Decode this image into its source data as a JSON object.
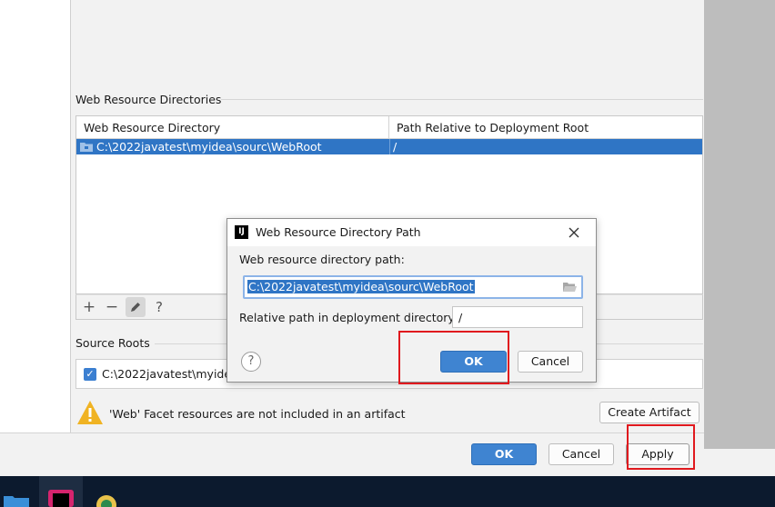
{
  "web_resource": {
    "section_title": "Web Resource Directories",
    "col_directory": "Web Resource Directory",
    "col_path": "Path Relative to Deployment Root",
    "rows": [
      {
        "directory": "C:\\2022javatest\\myidea\\sourc\\WebRoot",
        "path": "/"
      }
    ],
    "toolbar": {
      "add": "+",
      "remove": "−",
      "edit": "pencil-icon",
      "help": "?"
    }
  },
  "source_roots": {
    "section_title": "Source Roots",
    "item": "C:\\2022javatest\\myidea\\",
    "checked": true
  },
  "warning": {
    "text": "'Web' Facet resources are not included in an artifact",
    "create_artifact_label": "Create Artifact"
  },
  "footer": {
    "ok_label": "OK",
    "cancel_label": "Cancel",
    "apply_label": "Apply"
  },
  "dialog": {
    "title": "Web Resource Directory Path",
    "path_label": "Web resource directory path:",
    "path_value": "C:\\2022javatest\\myidea\\sourc\\WebRoot",
    "relative_label": "Relative path in deployment directory:",
    "relative_value": "/",
    "ok_label": "OK",
    "cancel_label": "Cancel",
    "help_label": "?"
  },
  "colors": {
    "accent": "#3f84d1",
    "selection": "#2f75c5",
    "highlight": "#e0191e",
    "warning": "#f0b323"
  }
}
